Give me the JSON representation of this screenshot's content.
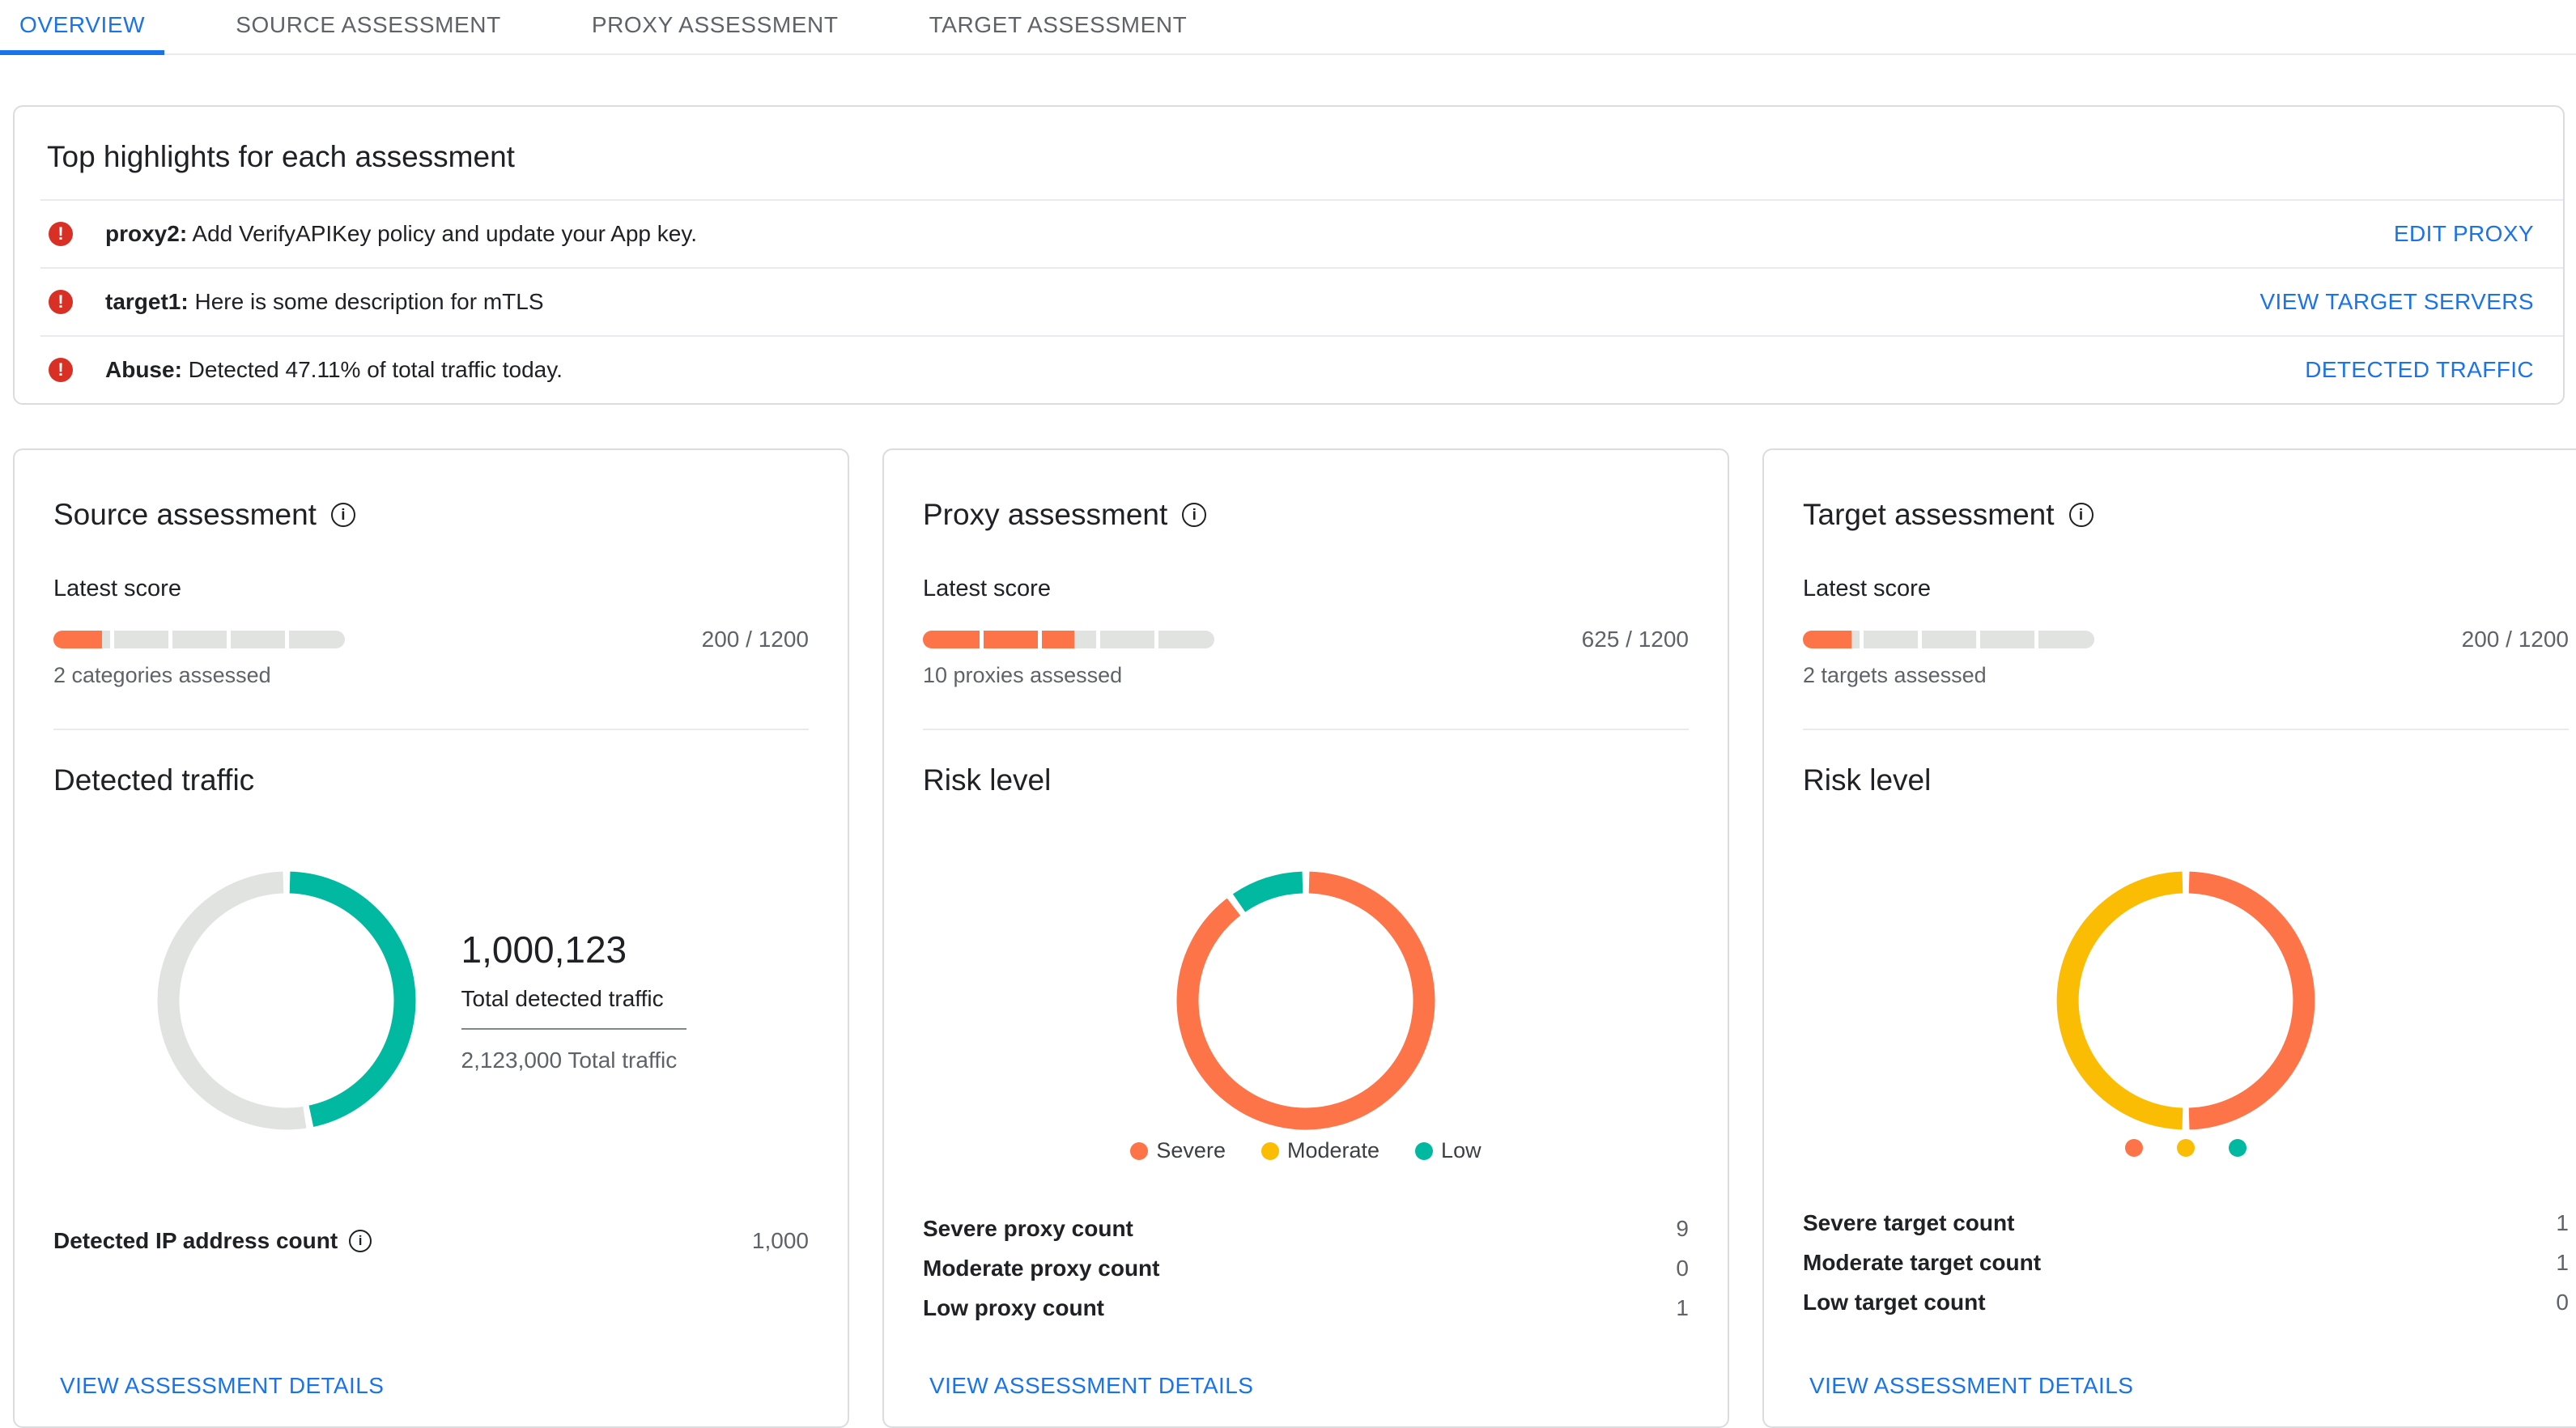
{
  "tabs": [
    {
      "label": "OVERVIEW",
      "active": true
    },
    {
      "label": "SOURCE ASSESSMENT",
      "active": false
    },
    {
      "label": "PROXY ASSESSMENT",
      "active": false
    },
    {
      "label": "TARGET ASSESSMENT",
      "active": false
    }
  ],
  "highlights": {
    "title": "Top highlights for each assessment",
    "rows": [
      {
        "name": "proxy2:",
        "text": " Add VerifyAPIKey policy and update your App key.",
        "link": "EDIT PROXY"
      },
      {
        "name": "target1:",
        "text": " Here is some description for mTLS",
        "link": "VIEW TARGET SERVERS"
      },
      {
        "name": "Abuse:",
        "text": " Detected 47.11% of total traffic today.",
        "link": "DETECTED TRAFFIC"
      }
    ]
  },
  "cards": {
    "source": {
      "title": "Source assessment",
      "score_label": "Latest score",
      "score_text": "200 / 1200",
      "assessed": "2 categories assessed",
      "section": "Detected traffic",
      "center_value": "1,000,123",
      "center_label": "Total detected traffic",
      "center_sub": "2,123,000 Total traffic",
      "count_label": "Detected IP address count",
      "count_value": "1,000",
      "link": "VIEW ASSESSMENT DETAILS"
    },
    "proxy": {
      "title": "Proxy assessment",
      "score_label": "Latest score",
      "score_text": "625 / 1200",
      "assessed": "10 proxies assessed",
      "section": "Risk level",
      "counts": [
        {
          "label": "Severe proxy count",
          "value": "9"
        },
        {
          "label": "Moderate proxy count",
          "value": "0"
        },
        {
          "label": "Low proxy count",
          "value": "1"
        }
      ],
      "link": "VIEW ASSESSMENT DETAILS"
    },
    "target": {
      "title": "Target assessment",
      "score_label": "Latest score",
      "score_text": "200 / 1200",
      "assessed": "2 targets assessed",
      "section": "Risk level",
      "counts": [
        {
          "label": "Severe target count",
          "value": "1"
        },
        {
          "label": "Moderate target count",
          "value": "1"
        },
        {
          "label": "Low target count",
          "value": "0"
        }
      ],
      "link": "VIEW ASSESSMENT DETAILS"
    }
  },
  "colors": {
    "severe": "#FC7448",
    "moderate": "#FBBC04",
    "low": "#00B9A0",
    "remainder_gray": "#E1E3E1",
    "link_blue": "#1A73E8",
    "error_red": "#D93025",
    "active_tab_blue": "#1A73E8"
  },
  "icons": {
    "alert": "error-icon",
    "info": "info-icon"
  },
  "chart_data": [
    {
      "id": "source-traffic",
      "type": "donut",
      "title": "Detected traffic",
      "legend": "none",
      "segments": [
        {
          "label": "Total detected traffic",
          "value": 1000123,
          "color": "#00B9A0"
        },
        {
          "label": "Remaining traffic",
          "value": 1122877,
          "color": "#E1E3E1"
        }
      ],
      "annotations": {
        "center_value": 1000123,
        "total_traffic": 2123000,
        "detected_percent": 47.11
      }
    },
    {
      "id": "proxy-risk",
      "type": "donut",
      "title": "Risk level",
      "legend": "labels",
      "segments": [
        {
          "label": "Severe",
          "value": 9,
          "color": "#FC7448"
        },
        {
          "label": "Moderate",
          "value": 0,
          "color": "#FBBC04"
        },
        {
          "label": "Low",
          "value": 1,
          "color": "#00B9A0"
        }
      ]
    },
    {
      "id": "target-risk",
      "type": "donut",
      "title": "Risk level",
      "legend": "dots",
      "segments": [
        {
          "label": "Severe",
          "value": 1,
          "color": "#FC7448"
        },
        {
          "label": "Moderate",
          "value": 1,
          "color": "#FBBC04"
        },
        {
          "label": "Low",
          "value": 0,
          "color": "#00B9A0"
        }
      ]
    },
    {
      "id": "source-score",
      "type": "bar",
      "label": "Latest score",
      "value": 200,
      "max": 1200,
      "fill_color": "#FC7448",
      "segments_count": 5
    },
    {
      "id": "proxy-score",
      "type": "bar",
      "label": "Latest score",
      "value": 625,
      "max": 1200,
      "fill_color": "#FC7448",
      "segments_count": 5
    },
    {
      "id": "target-score",
      "type": "bar",
      "label": "Latest score",
      "value": 200,
      "max": 1200,
      "fill_color": "#FC7448",
      "segments_count": 5
    }
  ]
}
